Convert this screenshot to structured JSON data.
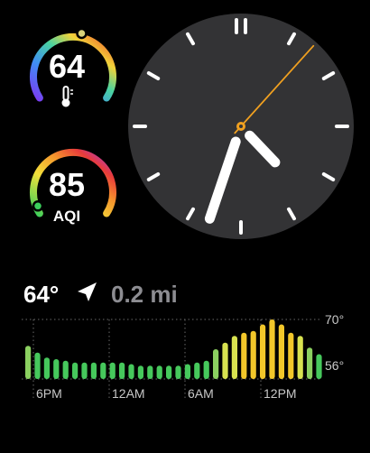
{
  "temperature_complication": {
    "value": "64",
    "icon": "thermometer-icon",
    "level": 0.55
  },
  "aqi_complication": {
    "value": "85",
    "label": "AQI",
    "level": 0.03
  },
  "clock": {
    "hour": 4,
    "minute": 33,
    "second": 7
  },
  "weather": {
    "temperature": "64°",
    "location_icon": "location-arrow-icon",
    "distance": "0.2 mi"
  },
  "forecast_chart": {
    "type": "bar",
    "x_labels": [
      "6PM",
      "12AM",
      "6AM",
      "12PM"
    ],
    "y_labels": [
      "70°",
      "56°"
    ],
    "ylim": [
      52,
      70
    ],
    "values": [
      62,
      60,
      58.5,
      58,
      57.5,
      57,
      57,
      57,
      57,
      57,
      57,
      56.5,
      56,
      56,
      56,
      56,
      56,
      56.5,
      57,
      57.5,
      61,
      63,
      65,
      66,
      66.5,
      68.5,
      70,
      68.5,
      66,
      65,
      61.5,
      59.5
    ],
    "color_scale": [
      "#46c85c",
      "#8bd060",
      "#d8e250",
      "#f2c72a"
    ]
  }
}
